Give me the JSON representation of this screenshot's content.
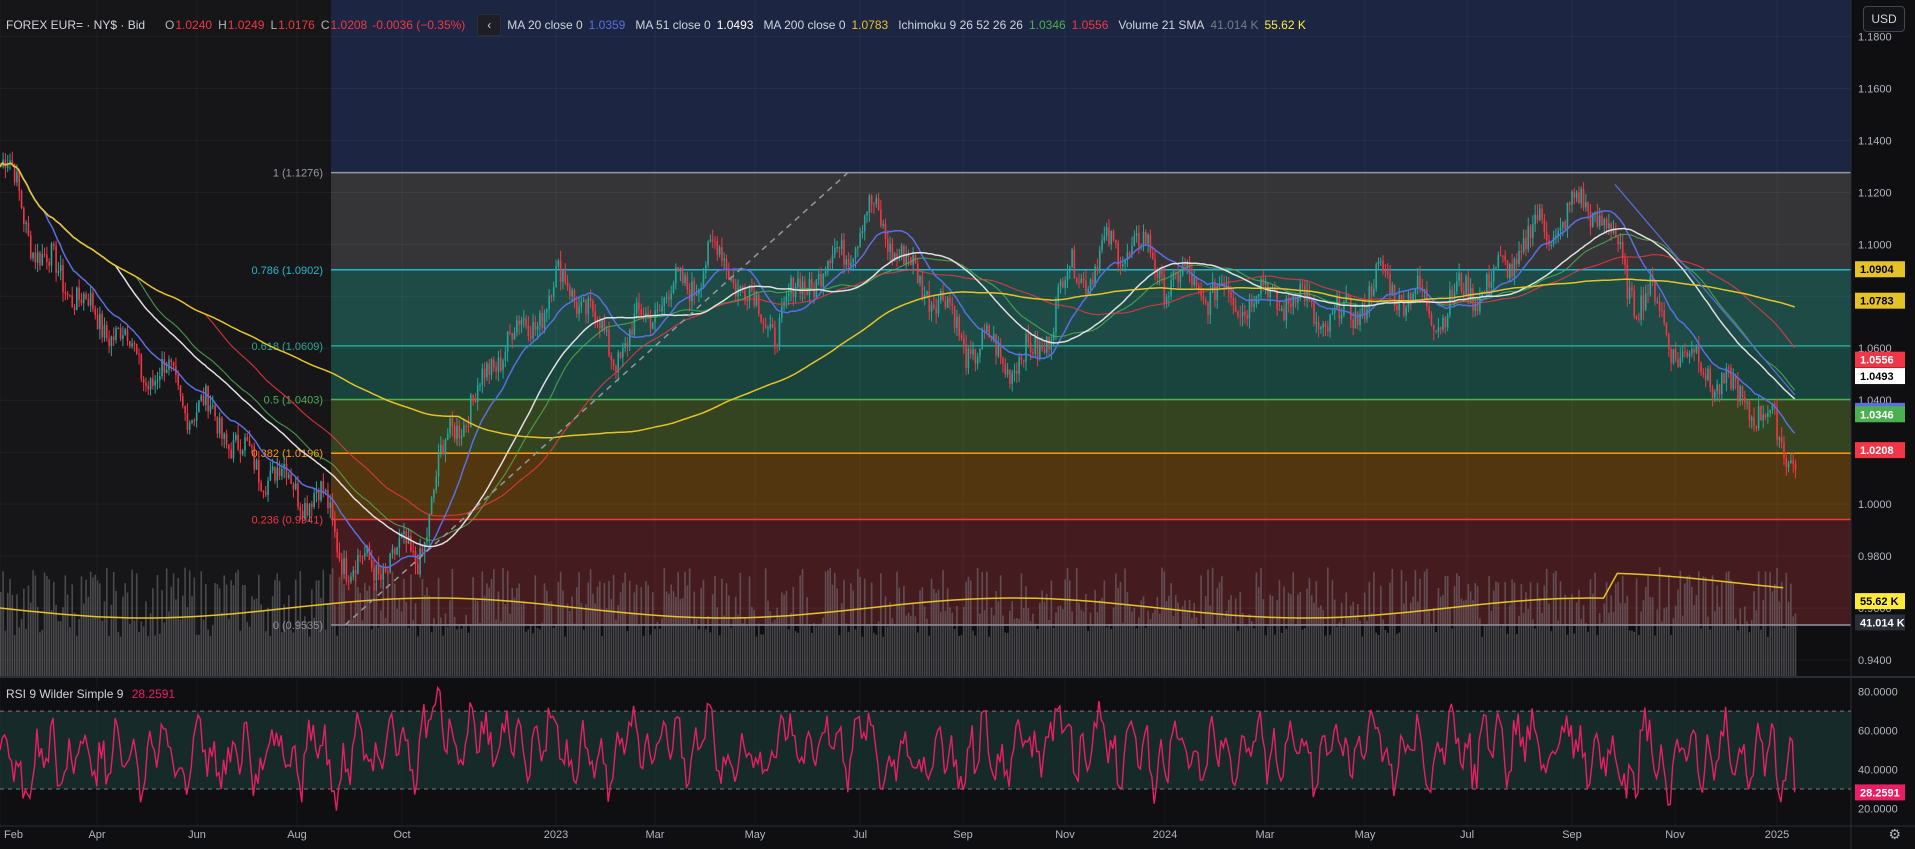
{
  "symbol": {
    "title": "FOREX EUR= · NY$ · Bid"
  },
  "ohlc": {
    "o_label": "O",
    "o": "1.0240",
    "h_label": "H",
    "h": "1.0249",
    "l_label": "L",
    "l": "1.0176",
    "c_label": "C",
    "c": "1.0208",
    "change": "-0.0036 (−0.35%)"
  },
  "indicators": [
    {
      "label": "MA 20 close 0",
      "values": [
        "1.0359"
      ],
      "colors": [
        "#5b6ee1"
      ]
    },
    {
      "label": "MA 51 close 0",
      "values": [
        "1.0493"
      ],
      "colors": [
        "#ffffff"
      ]
    },
    {
      "label": "MA 200 close 0",
      "values": [
        "1.0783"
      ],
      "colors": [
        "#e6c229"
      ]
    },
    {
      "label": "Ichimoku 9 26 52 26 26",
      "values": [
        "1.0346",
        "1.0556"
      ],
      "colors": [
        "#4caf50",
        "#f23645"
      ]
    },
    {
      "label": "Volume 21 SMA",
      "values": [
        "41.014 K",
        "55.62 K"
      ],
      "colors": [
        "#787b86",
        "#ffeb3b"
      ]
    }
  ],
  "currency": "USD",
  "price_axis": {
    "ticks": [
      "1.1800",
      "1.1600",
      "1.1400",
      "1.1200",
      "1.1000",
      "1.0800",
      "1.0600",
      "1.0400",
      "1.0200",
      "1.0000",
      "0.9800",
      "0.9600",
      "0.9400"
    ],
    "tick_values": [
      1.18,
      1.16,
      1.14,
      1.12,
      1.1,
      1.08,
      1.06,
      1.04,
      1.02,
      1.0,
      0.98,
      0.96,
      0.94
    ],
    "range": [
      0.9335,
      1.194
    ],
    "badges": [
      {
        "text": "1.0904",
        "value": 1.0904,
        "bg": "#e6c229",
        "fg": "#000000"
      },
      {
        "text": "1.0783",
        "value": 1.0783,
        "bg": "#e6c229",
        "fg": "#000000"
      },
      {
        "text": "1.0556",
        "value": 1.0556,
        "bg": "#f23645",
        "fg": "#ffffff"
      },
      {
        "text": "1.0493",
        "value": 1.0493,
        "bg": "#ffffff",
        "fg": "#000000"
      },
      {
        "text": "1.0359",
        "value": 1.0359,
        "bg": "#5b6ee1",
        "fg": "#ffffff"
      },
      {
        "text": "1.0346",
        "value": 1.0346,
        "bg": "#4caf50",
        "fg": "#ffffff"
      },
      {
        "text": "1.0208",
        "value": 1.0208,
        "bg": "#f23645",
        "fg": "#ffffff"
      },
      {
        "text": "55.62 K",
        "value": 0.9627,
        "bg": "#ffeb3b",
        "fg": "#000000"
      },
      {
        "text": "41.014 K",
        "value": 0.9545,
        "bg": "#2a2e39",
        "fg": "#ffffff"
      }
    ]
  },
  "fibonacci": [
    {
      "label": "1 (1.1276)",
      "value": 1.1276,
      "color": "#9598a1",
      "fill": "#3a3a3c"
    },
    {
      "label": "0.786 (1.0902)",
      "value": 1.0902,
      "color": "#22b7d1",
      "fill": "#20524d"
    },
    {
      "label": "0.618 (1.0609)",
      "value": 1.0609,
      "color": "#26a69a",
      "fill": "#1b4a43"
    },
    {
      "label": "0.5 (1.0403)",
      "value": 1.0403,
      "color": "#4caf50",
      "fill": "#3a4a22"
    },
    {
      "label": "0.382 (1.0196)",
      "value": 1.0196,
      "color": "#ff9800",
      "fill": "#5a3b10"
    },
    {
      "label": "0.236 (0.9941)",
      "value": 0.9941,
      "color": "#f23645",
      "fill": "#4a1e22"
    },
    {
      "label": "0 (0.9535)",
      "value": 0.9535,
      "color": "#9598a1",
      "fill": null
    }
  ],
  "time_axis": {
    "labels": [
      "Feb",
      "Apr",
      "Jun",
      "Aug",
      "Oct",
      "2023",
      "Mar",
      "May",
      "Jul",
      "Sep",
      "Nov",
      "2024",
      "Mar",
      "May",
      "Jul",
      "Sep",
      "Nov",
      "2025"
    ]
  },
  "rsi": {
    "label": "RSI 9 Wilder Simple 9",
    "value": "28.2591",
    "value_num": 28.2591,
    "ticks": [
      "80.0000",
      "60.0000",
      "40.0000",
      "20.0000"
    ],
    "tick_values": [
      80,
      60,
      40,
      20
    ],
    "range": [
      11,
      87
    ],
    "bands": [
      70,
      30
    ],
    "color": "#e91e63"
  },
  "colors": {
    "up": "#26a69a",
    "down": "#f23645",
    "bg": "#0f0f12",
    "region": "#1c2642"
  },
  "chart_data": {
    "type": "candlestick",
    "series_close": [
      {
        "x": "2022-02",
        "y": 1.13
      },
      {
        "x": "2022-03",
        "y": 1.09
      },
      {
        "x": "2022-04",
        "y": 1.07
      },
      {
        "x": "2022-05",
        "y": 1.05
      },
      {
        "x": "2022-06",
        "y": 1.035
      },
      {
        "x": "2022-07",
        "y": 1.015
      },
      {
        "x": "2022-08",
        "y": 1.005
      },
      {
        "x": "2022-09",
        "y": 0.975
      },
      {
        "x": "2022-10",
        "y": 0.98
      },
      {
        "x": "2022-11",
        "y": 1.035
      },
      {
        "x": "2022-12",
        "y": 1.065
      },
      {
        "x": "2023-01",
        "y": 1.085
      },
      {
        "x": "2023-02",
        "y": 1.06
      },
      {
        "x": "2023-03",
        "y": 1.08
      },
      {
        "x": "2023-04",
        "y": 1.095
      },
      {
        "x": "2023-05",
        "y": 1.07
      },
      {
        "x": "2023-06",
        "y": 1.09
      },
      {
        "x": "2023-07",
        "y": 1.11
      },
      {
        "x": "2023-08",
        "y": 1.085
      },
      {
        "x": "2023-09",
        "y": 1.06
      },
      {
        "x": "2023-10",
        "y": 1.055
      },
      {
        "x": "2023-11",
        "y": 1.09
      },
      {
        "x": "2023-12",
        "y": 1.1
      },
      {
        "x": "2024-01",
        "y": 1.085
      },
      {
        "x": "2024-02",
        "y": 1.08
      },
      {
        "x": "2024-03",
        "y": 1.08
      },
      {
        "x": "2024-04",
        "y": 1.07
      },
      {
        "x": "2024-05",
        "y": 1.085
      },
      {
        "x": "2024-06",
        "y": 1.075
      },
      {
        "x": "2024-07",
        "y": 1.085
      },
      {
        "x": "2024-08",
        "y": 1.105
      },
      {
        "x": "2024-09",
        "y": 1.115
      },
      {
        "x": "2024-10",
        "y": 1.08
      },
      {
        "x": "2024-11",
        "y": 1.055
      },
      {
        "x": "2024-12",
        "y": 1.04
      },
      {
        "x": "2025-01",
        "y": 1.0208
      }
    ],
    "ylim": [
      0.9335,
      1.194
    ],
    "xlabel": "",
    "ylabel": ""
  }
}
